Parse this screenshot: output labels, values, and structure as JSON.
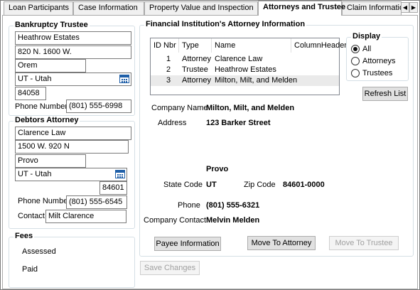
{
  "tabs": [
    "Loan Participants",
    "Case Information",
    "Property Value and Inspection",
    "Attorneys and Trustee",
    "Claim Information"
  ],
  "active_tab": "Attorneys and Trustee",
  "bankruptcy_trustee": {
    "title": "Bankruptcy Trustee",
    "name": "Heathrow Estates",
    "address": "820 N. 1600 W.",
    "city": "Orem",
    "state": "UT - Utah",
    "zip": "84058",
    "phone_label": "Phone Number",
    "phone": "(801) 555-6998"
  },
  "debtors_attorney": {
    "title": "Debtors Attorney",
    "name": "Clarence Law",
    "address": "1500 W. 920 N",
    "city": "Provo",
    "state": "UT - Utah",
    "zip": "84601",
    "phone_label": "Phone Number",
    "phone": "(801) 555-6545",
    "contact_label": "Contact",
    "contact": "Milt Clarence"
  },
  "fees": {
    "title": "Fees",
    "assessed_label": "Assessed",
    "paid_label": "Paid"
  },
  "fi_attorney": {
    "title": "Financial Institution's Attorney Information",
    "columns": [
      "ID Nbr",
      "Type",
      "Name",
      "ColumnHeader"
    ],
    "rows": [
      {
        "id": "1",
        "type": "Attorney",
        "name": "Clarence Law"
      },
      {
        "id": "2",
        "type": "Trustee",
        "name": "Heathrow Estates"
      },
      {
        "id": "3",
        "type": "Attorney",
        "name": "Milton, Milt, and Melden"
      }
    ],
    "display": {
      "title": "Display",
      "options": [
        "All",
        "Attorneys",
        "Trustees"
      ],
      "selected": "All"
    },
    "refresh_label": "Refresh List",
    "company_name_label": "Company Name",
    "company_name": "Milton, Milt, and Melden",
    "address_label": "Address",
    "address": "123 Barker Street",
    "city": "Provo",
    "state_label": "State Code",
    "state": "UT",
    "zip_label": "Zip Code",
    "zip": "84601-0000",
    "phone_label": "Phone",
    "phone": "(801) 555-6321",
    "contact_label": "Company Contact",
    "contact": "Melvin Melden",
    "payee_btn": "Payee Information",
    "move_attorney_btn": "Move To Attorney",
    "move_trustee_btn": "Move To Trustee"
  },
  "save_btn": "Save Changes"
}
